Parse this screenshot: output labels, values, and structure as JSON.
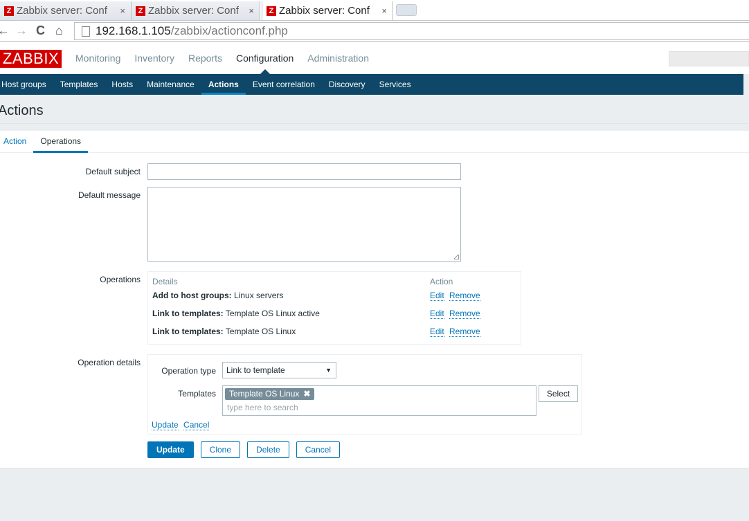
{
  "browser": {
    "tabs": [
      {
        "title": "Zabbix server: Conf",
        "favicon": "Z"
      },
      {
        "title": "Zabbix server: Conf",
        "favicon": "Z"
      },
      {
        "title": "Zabbix server: Conf",
        "favicon": "Z"
      }
    ],
    "close_glyph": "×",
    "url_host": "192.168.1.105",
    "url_path": "/zabbix/actionconf.php",
    "nav_icons": {
      "back": "←",
      "forward": "→",
      "reload": "C",
      "home": "⌂"
    }
  },
  "header": {
    "logo": "ZABBIX",
    "main_menu": [
      "Monitoring",
      "Inventory",
      "Reports",
      "Configuration",
      "Administration"
    ],
    "active_main": "Configuration",
    "sub_menu": [
      "Host groups",
      "Templates",
      "Hosts",
      "Maintenance",
      "Actions",
      "Event correlation",
      "Discovery",
      "Services"
    ],
    "active_sub": "Actions"
  },
  "page": {
    "title": "Actions",
    "tabs": [
      "Action",
      "Operations"
    ],
    "active_tab": "Operations"
  },
  "form": {
    "default_subject_label": "Default subject",
    "default_subject_value": "",
    "default_message_label": "Default message",
    "default_message_value": "",
    "operations_label": "Operations",
    "operations_table": {
      "headers": {
        "details": "Details",
        "action": "Action"
      },
      "rows": [
        {
          "key": "Add to host groups:",
          "value": "Linux servers",
          "edit": "Edit",
          "remove": "Remove"
        },
        {
          "key": "Link to templates:",
          "value": "Template OS Linux active",
          "edit": "Edit",
          "remove": "Remove"
        },
        {
          "key": "Link to templates:",
          "value": "Template OS Linux",
          "edit": "Edit",
          "remove": "Remove"
        }
      ]
    },
    "operation_details_label": "Operation details",
    "operation_type_label": "Operation type",
    "operation_type_value": "Link to template",
    "dropdown_arrow": "▼",
    "templates_label": "Templates",
    "template_chips": [
      "Template OS Linux"
    ],
    "chip_remove_glyph": "✖",
    "templates_placeholder": "type here to search",
    "select_button": "Select",
    "detail_update_link": "Update",
    "detail_cancel_link": "Cancel"
  },
  "buttons": {
    "update": "Update",
    "clone": "Clone",
    "delete": "Delete",
    "cancel": "Cancel"
  }
}
